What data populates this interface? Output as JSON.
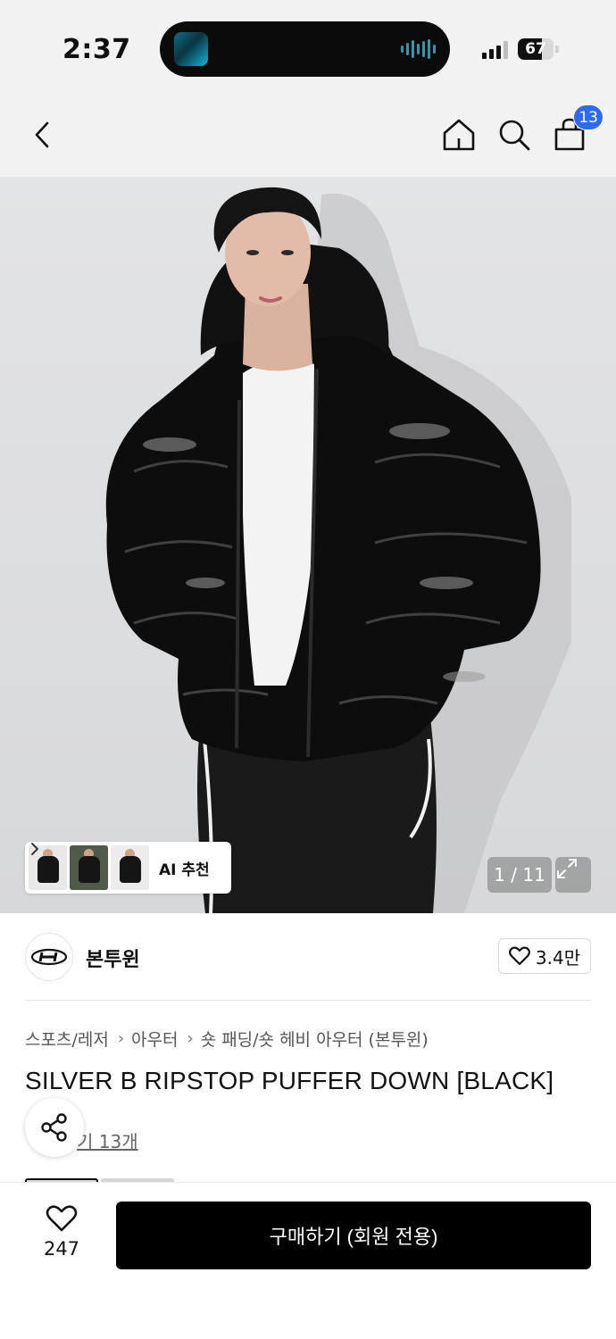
{
  "status_bar": {
    "time": "2:37",
    "battery_level": "67",
    "icons": [
      "signal-icon",
      "battery-icon"
    ]
  },
  "nav": {
    "cart_count": "13",
    "icons": [
      "back-icon",
      "home-icon",
      "search-icon",
      "cart-icon"
    ]
  },
  "gallery": {
    "ai_recommend_label": "AI 추천",
    "counter": "1 / 11",
    "icons": [
      "chevron-right-icon",
      "expand-icon"
    ]
  },
  "brand": {
    "name": "본투윈",
    "likes": "3.4만",
    "icons": [
      "heart-icon"
    ]
  },
  "breadcrumb": [
    "스포츠/레저",
    "아우터",
    "숏 패딩/숏 헤비 아우터 (본투윈)"
  ],
  "product": {
    "title": "SILVER B RIPSTOP PUFFER DOWN [BLACK]",
    "review_link": "기 13개"
  },
  "bottom_bar": {
    "wish_count": "247",
    "buy_label": "구매하기 (회원 전용)",
    "icons": [
      "heart-icon",
      "share-icon"
    ]
  },
  "colors": {
    "badge": "#2f6bef",
    "buy_button": "#000000",
    "header_bg": "#f2f2f2"
  }
}
